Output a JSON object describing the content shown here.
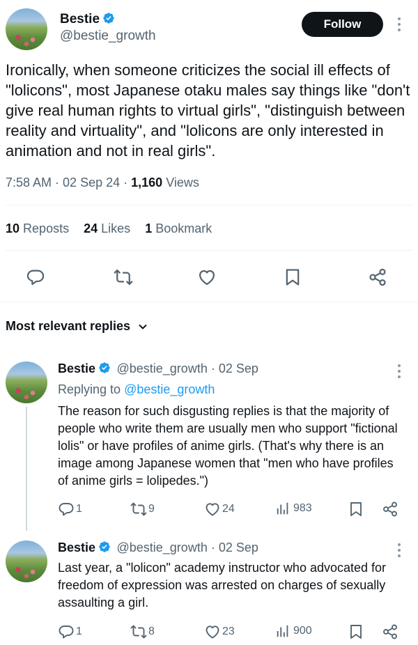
{
  "main_tweet": {
    "name": "Bestie",
    "handle": "@bestie_growth",
    "follow_label": "Follow",
    "text": "Ironically, when someone criticizes the social ill effects of \"lolicons\", most Japanese otaku males say things like \"don't give real human rights to virtual girls\", \"distinguish between reality and virtuality\", and \"lolicons are only interested in animation and not in real girls\".",
    "time": "7:58 AM",
    "date": "02 Sep 24",
    "views_count": "1,160",
    "views_label": "Views",
    "reposts_count": "10",
    "reposts_label": "Reposts",
    "likes_count": "24",
    "likes_label": "Likes",
    "bookmarks_count": "1",
    "bookmarks_label": "Bookmark"
  },
  "replies_header": "Most relevant replies",
  "replies": [
    {
      "name": "Bestie",
      "handle": "@bestie_growth",
      "date": "02 Sep",
      "replying_prefix": "Replying to",
      "replying_to": "@bestie_growth",
      "text": "The reason for such disgusting replies is that the majority of people who write them are usually men who support \"fictional lolis\" or have profiles of anime girls. (That's why there is an image among Japanese women that \"men who have profiles of anime girls = lolipedes.\")",
      "replies": "1",
      "reposts": "9",
      "likes": "24",
      "views": "983"
    },
    {
      "name": "Bestie",
      "handle": "@bestie_growth",
      "date": "02 Sep",
      "text": "Last year, a \"lolicon\" academy instructor who advocated for freedom of expression was arrested on charges of sexually assaulting a girl.",
      "replies": "1",
      "reposts": "8",
      "likes": "23",
      "views": "900"
    }
  ],
  "colors": {
    "accent": "#1d9bf0",
    "text": "#0f1419",
    "secondary": "#536471",
    "verified": "#1d9bf0"
  },
  "icons": [
    "verified-badge-icon",
    "more-icon",
    "reply-icon",
    "repost-icon",
    "like-icon",
    "bookmark-icon",
    "share-icon",
    "views-icon",
    "chevron-down-icon"
  ]
}
